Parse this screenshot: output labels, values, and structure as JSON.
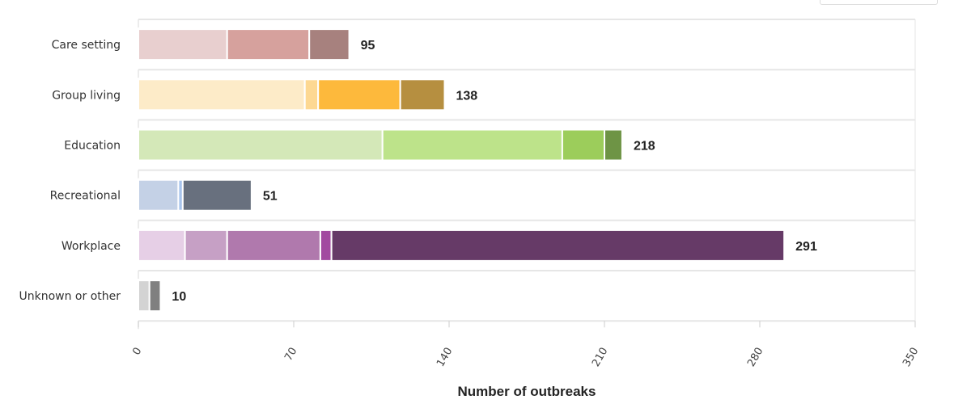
{
  "chart_data": {
    "type": "bar",
    "orientation": "horizontal",
    "stacked": true,
    "categories": [
      "Care setting",
      "Group living",
      "Education",
      "Recreational",
      "Workplace",
      "Unknown or other"
    ],
    "stacks": [
      {
        "category": "Care setting",
        "segments": [
          40,
          37,
          18
        ],
        "colors": [
          "#e8cfcf",
          "#d6a19d",
          "#a7817e"
        ],
        "total": 95
      },
      {
        "category": "Group living",
        "segments": [
          75,
          6,
          37,
          20
        ],
        "colors": [
          "#fdebc8",
          "#fdd892",
          "#fdb93c",
          "#b68f40"
        ],
        "total": 138
      },
      {
        "category": "Education",
        "segments": [
          110,
          81,
          19,
          8
        ],
        "colors": [
          "#d4e8b8",
          "#bde38a",
          "#9ccd5b",
          "#6e9445"
        ],
        "total": 218
      },
      {
        "category": "Recreational",
        "segments": [
          18,
          2,
          31
        ],
        "colors": [
          "#c4d1e6",
          "#a8c4ec",
          "#68707e"
        ],
        "total": 51
      },
      {
        "category": "Workplace",
        "segments": [
          21,
          19,
          42,
          5,
          204
        ],
        "colors": [
          "#e6cfe6",
          "#c6a0c5",
          "#b079ad",
          "#a24aa0",
          "#663a67"
        ],
        "total": 291
      },
      {
        "category": "Unknown or other",
        "segments": [
          5,
          5
        ],
        "colors": [
          "#d3d3d3",
          "#808080"
        ],
        "total": 10
      }
    ],
    "xlim": [
      0,
      350
    ],
    "xticks": [
      0,
      70,
      140,
      210,
      280,
      350
    ],
    "xlabel": "Number of outbreaks",
    "ylabel": "",
    "grid": "horizontal separators between categories",
    "legend": "none"
  }
}
